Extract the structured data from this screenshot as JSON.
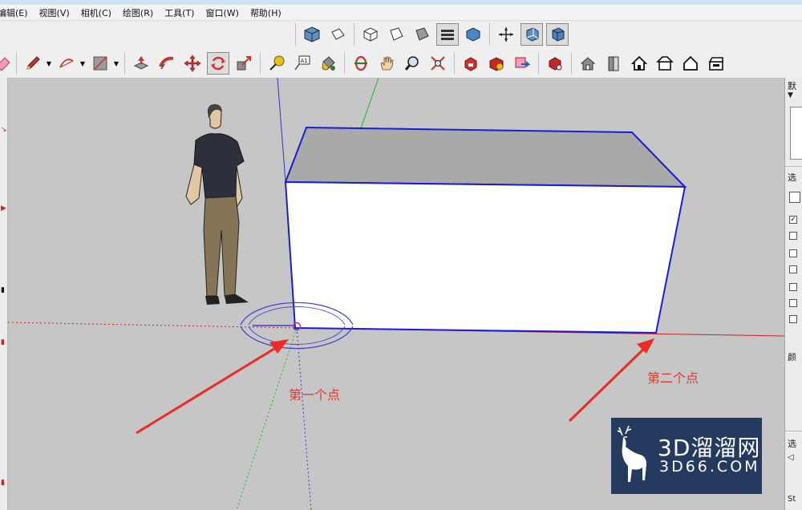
{
  "menu": [
    "编辑(E)",
    "视图(V)",
    "相机(C)",
    "绘图(R)",
    "工具(T)",
    "窗口(W)",
    "帮助(H)"
  ],
  "toolbar_row1": [
    {
      "name": "iso-view-icon"
    },
    {
      "name": "top-view-icon"
    },
    {
      "name": "front-view-icon"
    },
    {
      "name": "right-view-icon"
    },
    {
      "name": "back-view-icon"
    },
    {
      "name": "left-view-icon"
    },
    {
      "name": "bottom-view-icon"
    },
    {
      "name": "xray-style-icon"
    },
    {
      "name": "back-edges-style-icon"
    },
    {
      "name": "wireframe-style-icon"
    },
    {
      "name": "hidden-line-style-icon"
    }
  ],
  "toolbar_row2": [
    {
      "name": "eraser-icon"
    },
    {
      "name": "pencil-icon"
    },
    {
      "name": "arc-icon"
    },
    {
      "name": "shape-icon"
    },
    {
      "name": "push-pull-icon"
    },
    {
      "name": "follow-me-icon"
    },
    {
      "name": "move-icon"
    },
    {
      "name": "rotate-icon"
    },
    {
      "name": "scale-icon"
    },
    {
      "name": "tape-measure-icon"
    },
    {
      "name": "text-icon"
    },
    {
      "name": "paint-bucket-icon"
    },
    {
      "name": "orbit-icon"
    },
    {
      "name": "pan-icon"
    },
    {
      "name": "zoom-icon"
    },
    {
      "name": "zoom-extents-icon"
    },
    {
      "name": "warehouse-icon"
    },
    {
      "name": "extension-warehouse-icon"
    },
    {
      "name": "share-model-icon"
    },
    {
      "name": "extension-manager-icon"
    },
    {
      "name": "warehouse-house-icon"
    },
    {
      "name": "door-icon"
    },
    {
      "name": "house-icon"
    },
    {
      "name": "house-front-icon"
    },
    {
      "name": "house-outline-icon"
    },
    {
      "name": "house-side-icon"
    }
  ],
  "right_panel": {
    "header_char": "默",
    "section1_char": "选",
    "section2_char": "颜",
    "section3_char": "选",
    "bottom_text": "St"
  },
  "viewport": {
    "annotation_first": "第一个点",
    "annotation_second": "第二个点"
  },
  "watermark": {
    "line1": "3D溜溜网",
    "line2": "3D66.COM"
  },
  "colors": {
    "canvas": "#c6c6c6",
    "selection_edge": "#1c1cd4",
    "arrow_red": "#ee2a24",
    "axis_red": "#cf2020",
    "axis_green": "#1fb51f",
    "axis_blue": "#3434c8",
    "watermark_bg": "#253a5f"
  }
}
